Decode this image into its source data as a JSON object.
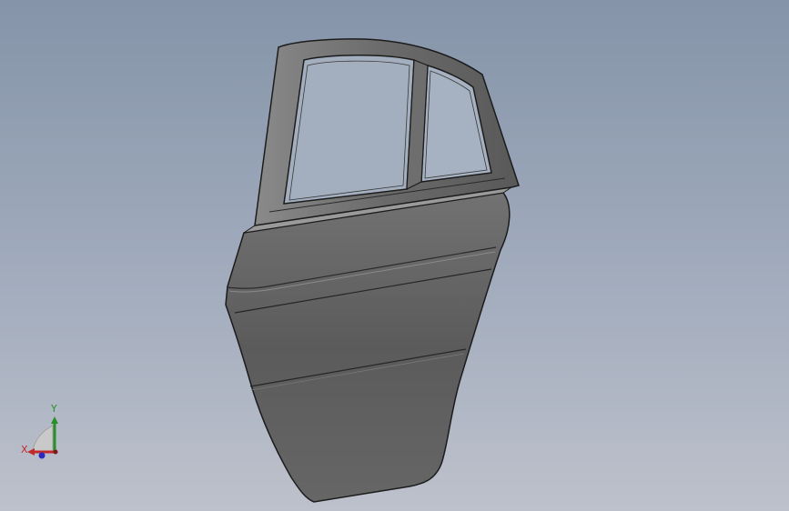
{
  "viewport": {
    "background_top": "#8594a9",
    "background_bottom": "#bdc1cb"
  },
  "model": {
    "body_color": "#5f5f5f",
    "edge_color": "#1c1c1c",
    "highlight_color": "#9a9a9a"
  },
  "triad": {
    "x_label": "X",
    "y_label": "Y",
    "x_color": "#c22a2a",
    "y_color": "#2a8f2a",
    "z_color": "#2a2ac2"
  }
}
